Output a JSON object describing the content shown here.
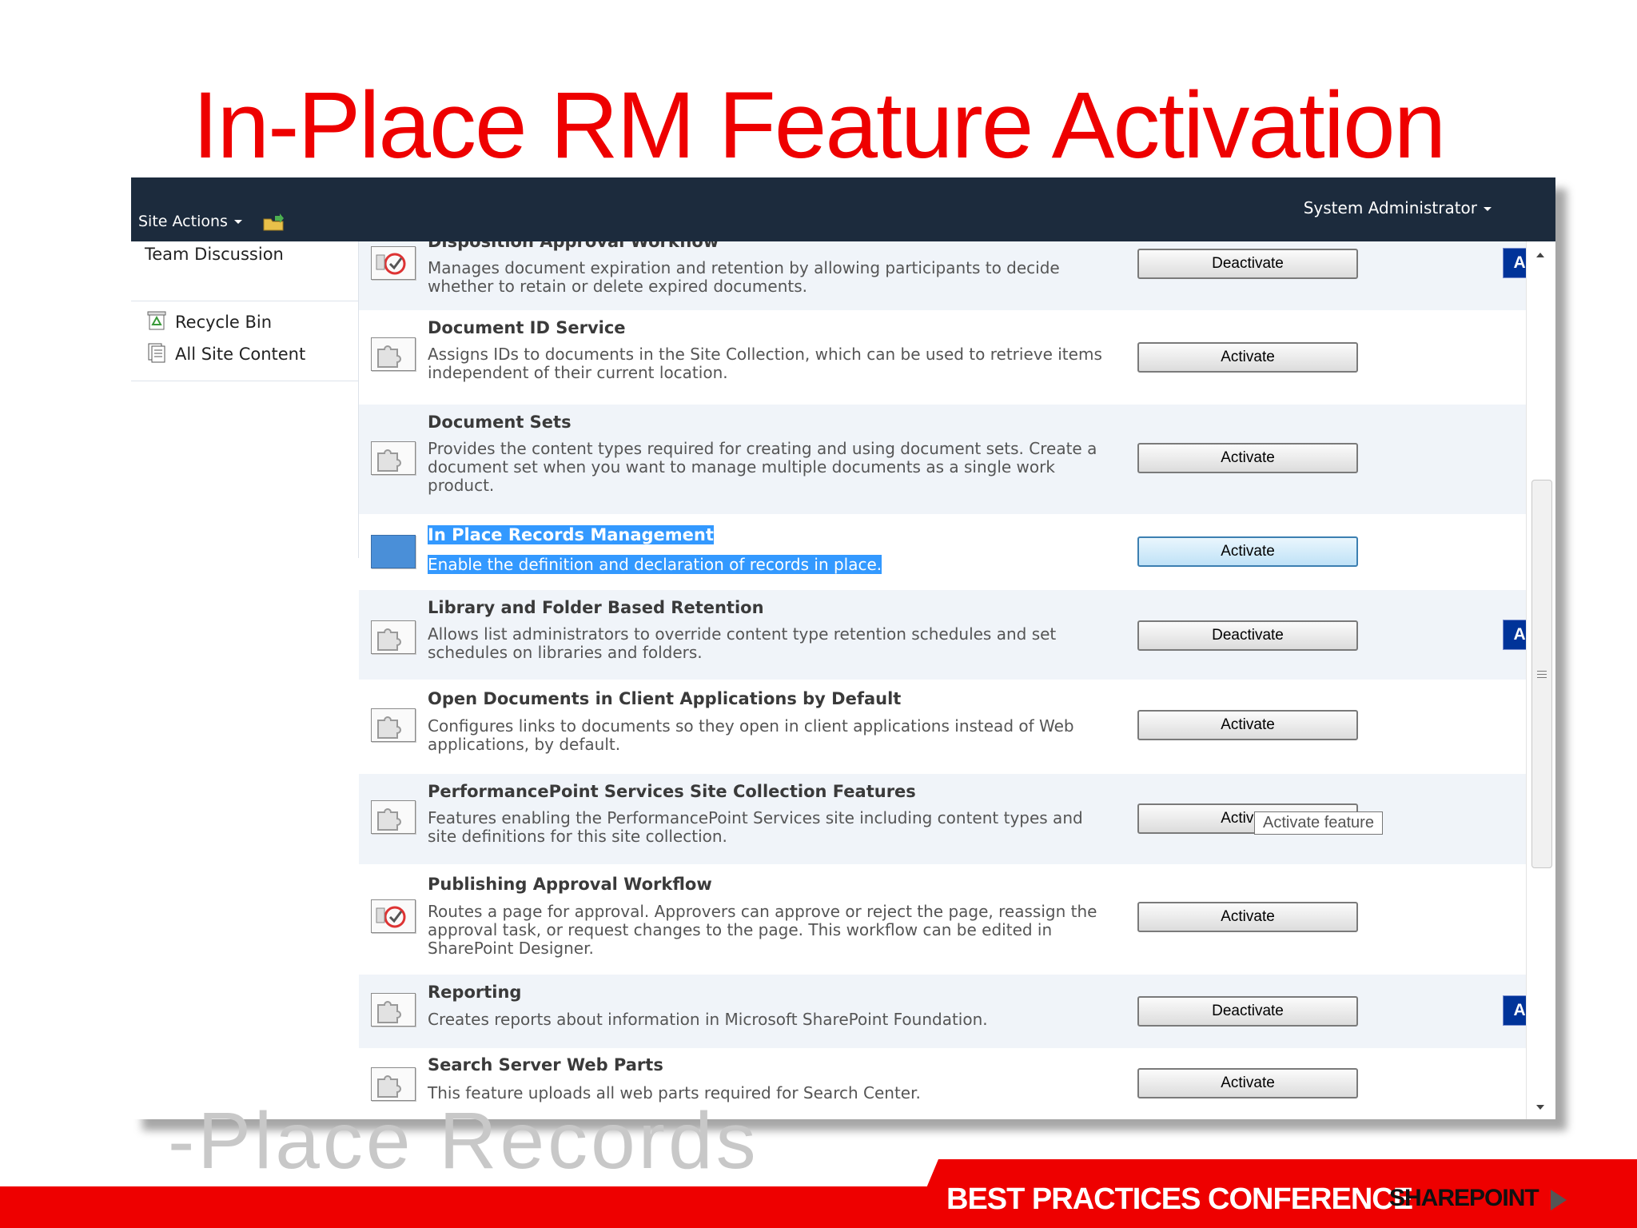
{
  "slide": {
    "title": "In-Place RM Feature Activation",
    "ghost_text": "-Place Records",
    "footer_text": "BEST PRACTICES CONFERENCE",
    "footer_brand": "SHAREPOINT"
  },
  "ribbon": {
    "site_actions": "Site Actions",
    "user": "System Administrator"
  },
  "leftnav": {
    "team_discussion": "Team Discussion",
    "recycle_bin": "Recycle Bin",
    "all_site_content": "All Site Content"
  },
  "tooltip": "Activate feature",
  "features": [
    {
      "name": "Disposition Approval Workflow",
      "description": "Manages document expiration and retention by allowing participants to decide whether to retain or delete expired documents.",
      "button": "Deactivate",
      "status": "Active",
      "icon": "workflow-icon"
    },
    {
      "name": "Document ID Service",
      "description": "Assigns IDs to documents in the Site Collection, which can be used to retrieve items independent of their current location.",
      "button": "Activate",
      "status": "",
      "icon": "feature-puzzle-icon"
    },
    {
      "name": "Document Sets",
      "description": "Provides the content types required for creating and using document sets. Create a document set when you want to manage multiple documents as a single work product.",
      "button": "Activate",
      "status": "",
      "icon": "feature-puzzle-icon"
    },
    {
      "name": "In Place Records Management",
      "description": "Enable the definition and declaration of records in place.",
      "button": "Activate",
      "status": "",
      "icon": "feature-puzzle-icon",
      "selected": true
    },
    {
      "name": "Library and Folder Based Retention",
      "description": "Allows list administrators to override content type retention schedules and set schedules on libraries and folders.",
      "button": "Deactivate",
      "status": "Active",
      "icon": "feature-puzzle-icon"
    },
    {
      "name": "Open Documents in Client Applications by Default",
      "description": "Configures links to documents so they open in client applications instead of Web applications, by default.",
      "button": "Activate",
      "status": "",
      "icon": "feature-puzzle-icon"
    },
    {
      "name": "PerformancePoint Services Site Collection Features",
      "description": "Features enabling the PerformancePoint Services site including content types and site definitions for this site collection.",
      "button": "Activate",
      "status": "",
      "icon": "feature-puzzle-icon"
    },
    {
      "name": "Publishing Approval Workflow",
      "description": "Routes a page for approval. Approvers can approve or reject the page, reassign the approval task, or request changes to the page. This workflow can be edited in SharePoint Designer.",
      "button": "Activate",
      "status": "",
      "icon": "workflow-icon"
    },
    {
      "name": "Reporting",
      "description": "Creates reports about information in Microsoft SharePoint Foundation.",
      "button": "Deactivate",
      "status": "Active",
      "icon": "feature-puzzle-icon"
    },
    {
      "name": "Search Server Web Parts",
      "description": "This feature uploads all web parts required for Search Center.",
      "button": "Activate",
      "status": "",
      "icon": "feature-puzzle-icon"
    }
  ]
}
